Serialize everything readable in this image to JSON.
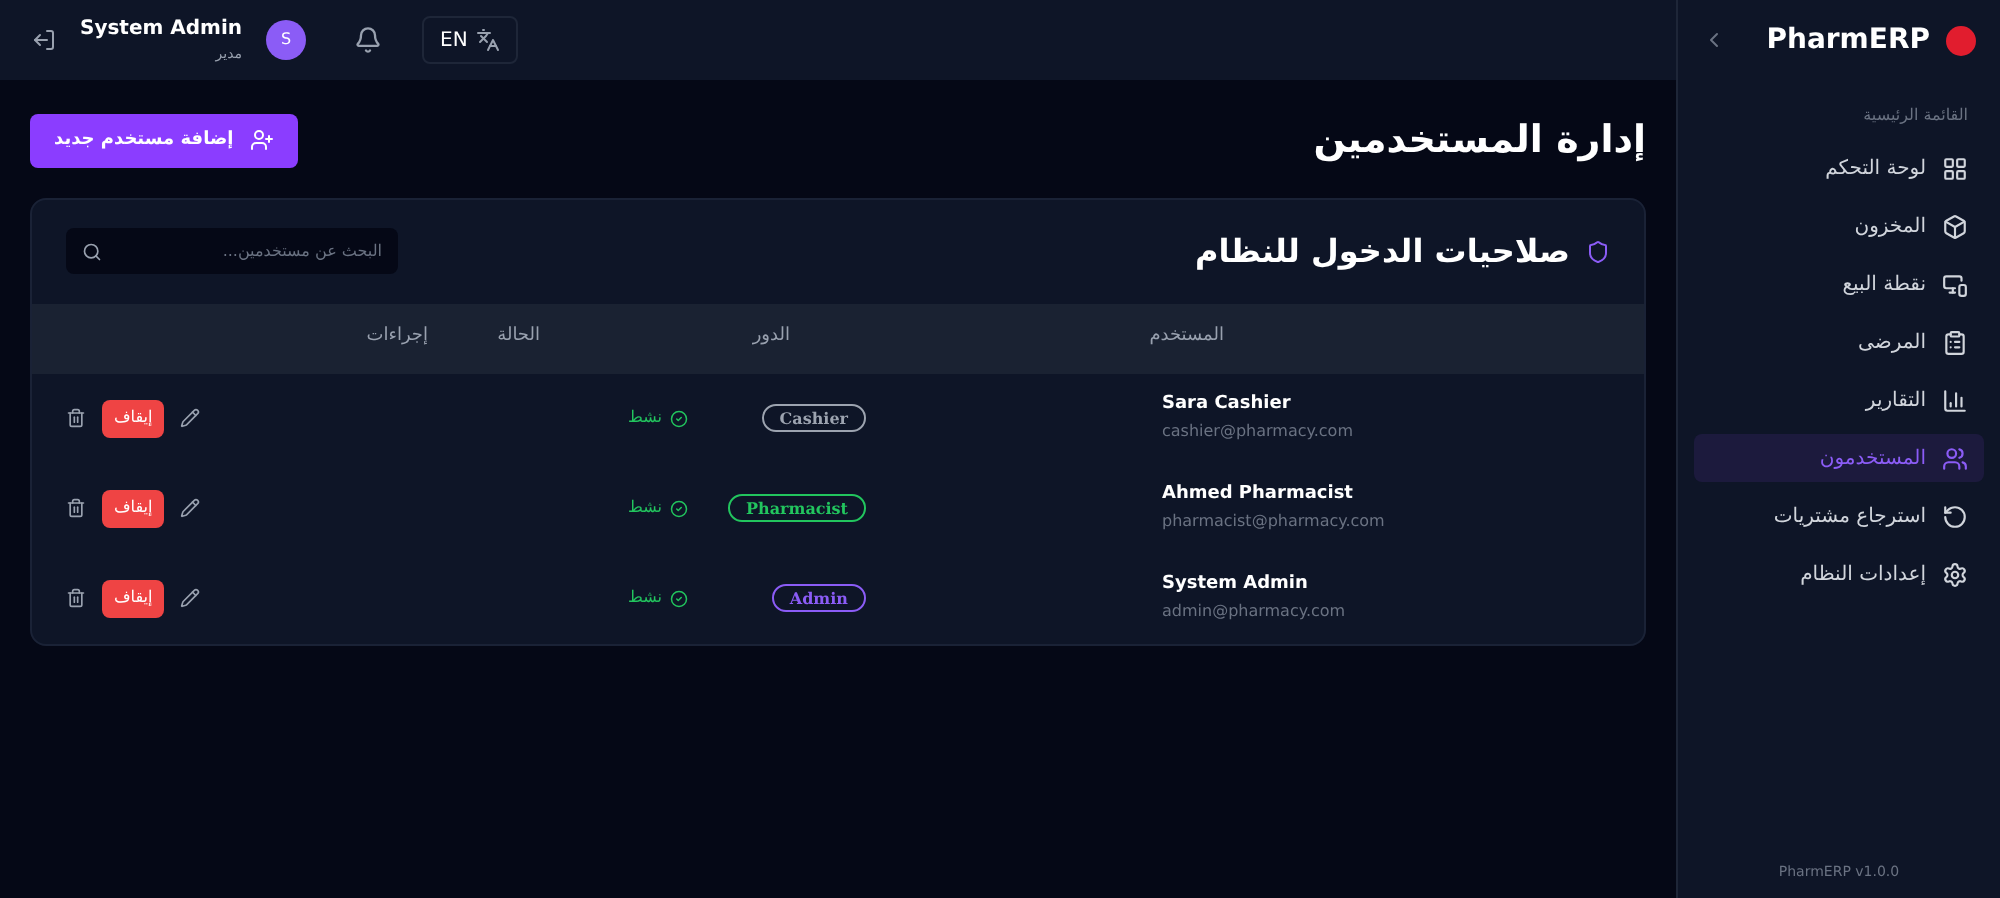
{
  "sidebar": {
    "brand": "PharmERP",
    "section_label": "القائمة الرئيسية",
    "items": [
      {
        "label": "لوحة التحكم",
        "selected": false
      },
      {
        "label": "المخزون",
        "selected": false
      },
      {
        "label": "نقطة البيع",
        "selected": false
      },
      {
        "label": "المرضى",
        "selected": false
      },
      {
        "label": "التقارير",
        "selected": false
      },
      {
        "label": "المستخدمون",
        "selected": true
      },
      {
        "label": "استرجاع مشتريات",
        "selected": false
      },
      {
        "label": "إعدادات النظام",
        "selected": false
      }
    ],
    "version": "PharmERP v1.0.0"
  },
  "topbar": {
    "language": "EN",
    "user_name": "System Admin",
    "user_role": "مدير",
    "avatar_initial": "S"
  },
  "page": {
    "title": "إدارة المستخدمين",
    "add_button": "إضافة مستخدم جديد"
  },
  "card": {
    "title": "صلاحيات الدخول للنظام",
    "search_placeholder": "البحث عن مستخدمين...",
    "columns": [
      "المستخدم",
      "الدور",
      "الحالة",
      "إجراءات"
    ],
    "rows": [
      {
        "name": "Sara Cashier",
        "email": "cashier@pharmacy.com",
        "role": "Cashier",
        "color": "#9ca3af",
        "status": "نشط",
        "stop_button": "إيقاف"
      },
      {
        "name": "Ahmed Pharmacist",
        "email": "pharmacist@pharmacy.com",
        "role": "Pharmacist",
        "color": "#22c55e",
        "status": "نشط",
        "stop_button": "إيقاف"
      },
      {
        "name": "System Admin",
        "email": "admin@pharmacy.com",
        "role": "Admin",
        "color": "#8b5cf6",
        "status": "نشط",
        "stop_button": "إيقاف"
      }
    ]
  }
}
